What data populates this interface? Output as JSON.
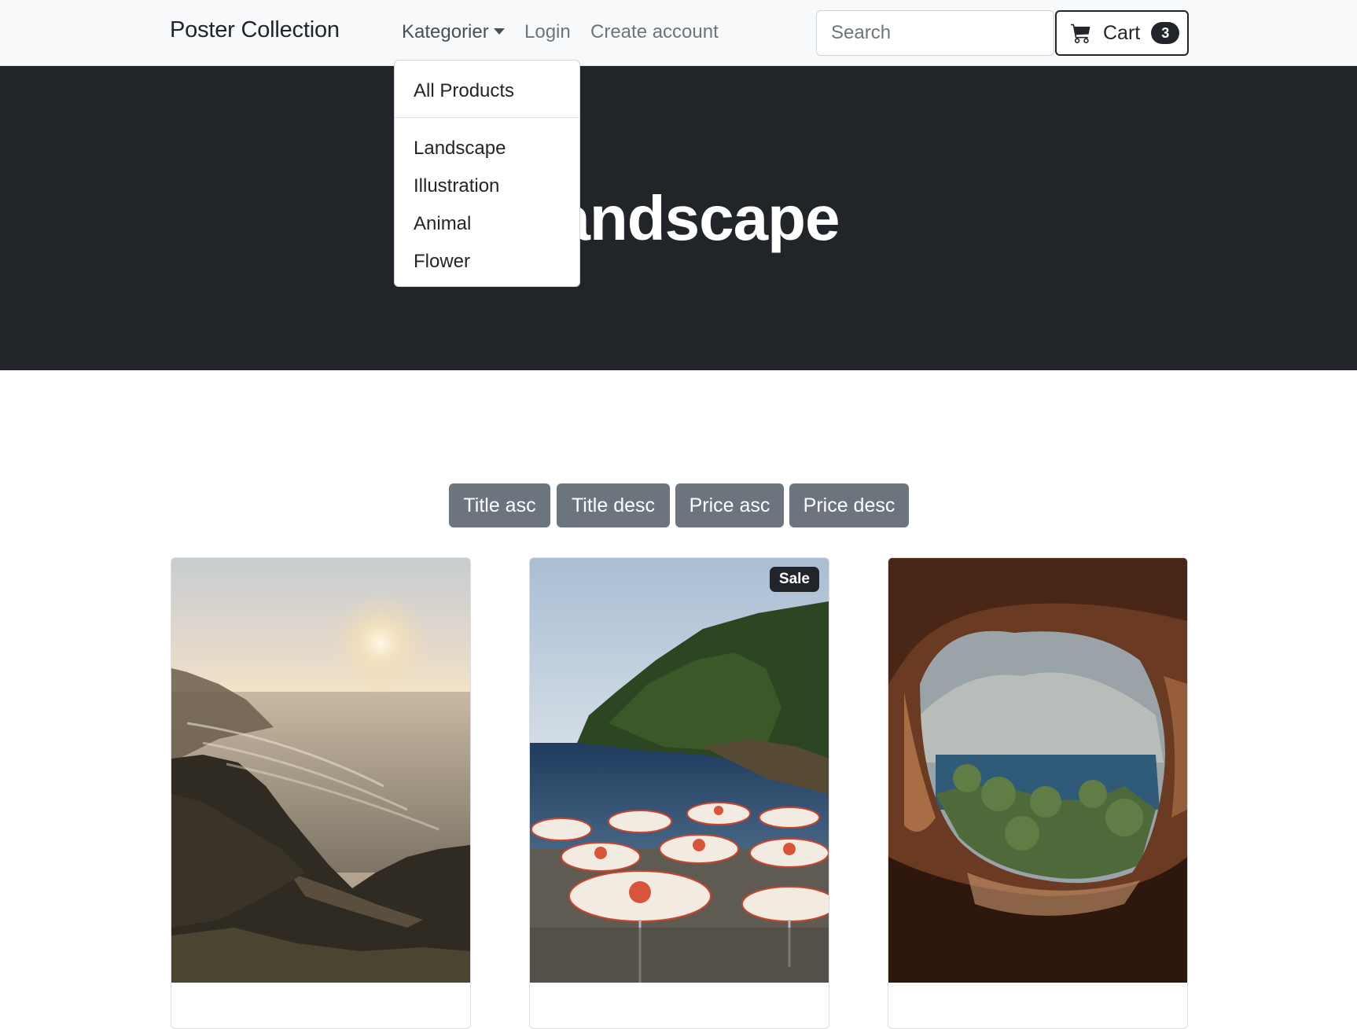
{
  "navbar": {
    "brand": "Poster Collection",
    "dropdown_label": "Kategorier",
    "login": "Login",
    "create_account": "Create account",
    "search_placeholder": "Search",
    "cart_label": "Cart",
    "cart_count": "3"
  },
  "dropdown": {
    "all_products": "All Products",
    "items": [
      "Landscape",
      "Illustration",
      "Animal",
      "Flower"
    ]
  },
  "hero": {
    "title": "Landscape"
  },
  "sort": {
    "buttons": [
      "Title asc",
      "Title desc",
      "Price asc",
      "Price desc"
    ]
  },
  "products": [
    {
      "image": "sunset-coast-photo",
      "sale": false
    },
    {
      "image": "beach-umbrellas-photo",
      "sale": true,
      "badge": "Sale"
    },
    {
      "image": "cave-view-photo",
      "sale": false
    }
  ],
  "colors": {
    "navbar_bg": "#f8f9fa",
    "hero_bg": "#212529",
    "secondary_button": "#6c757d",
    "dark": "#212529"
  }
}
